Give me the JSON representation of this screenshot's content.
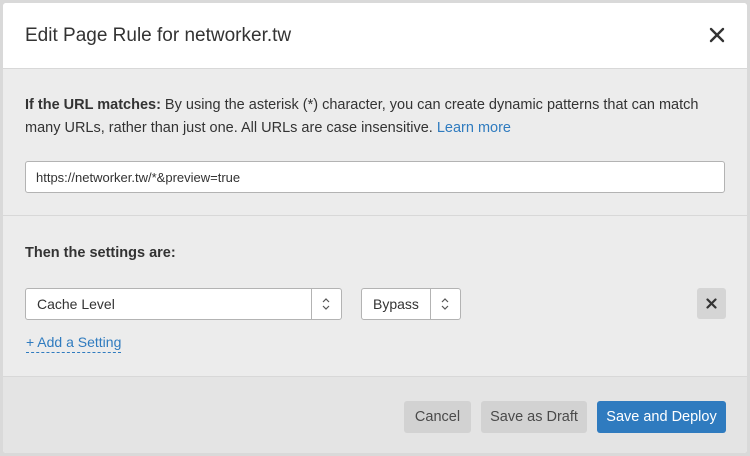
{
  "dialog": {
    "title": "Edit Page Rule for networker.tw",
    "close_icon": "close-icon"
  },
  "url_section": {
    "label": "If the URL matches:",
    "description": " By using the asterisk (*) character, you can create dynamic patterns that can match many URLs, rather than just one. All URLs are case insensitive. ",
    "learn_more": "Learn more",
    "url_value": "https://networker.tw/*&preview=true"
  },
  "settings_section": {
    "title": "Then the settings are:",
    "rows": [
      {
        "setting": "Cache Level",
        "value": "Bypass",
        "remove_icon": "remove-icon"
      }
    ],
    "add_setting": "+ Add a Setting"
  },
  "footer": {
    "cancel": "Cancel",
    "save_draft": "Save as Draft",
    "save_deploy": "Save and Deploy"
  },
  "colors": {
    "accent": "#2f7bbf",
    "panel": "#ececec",
    "button_secondary": "#d2d2d2"
  }
}
